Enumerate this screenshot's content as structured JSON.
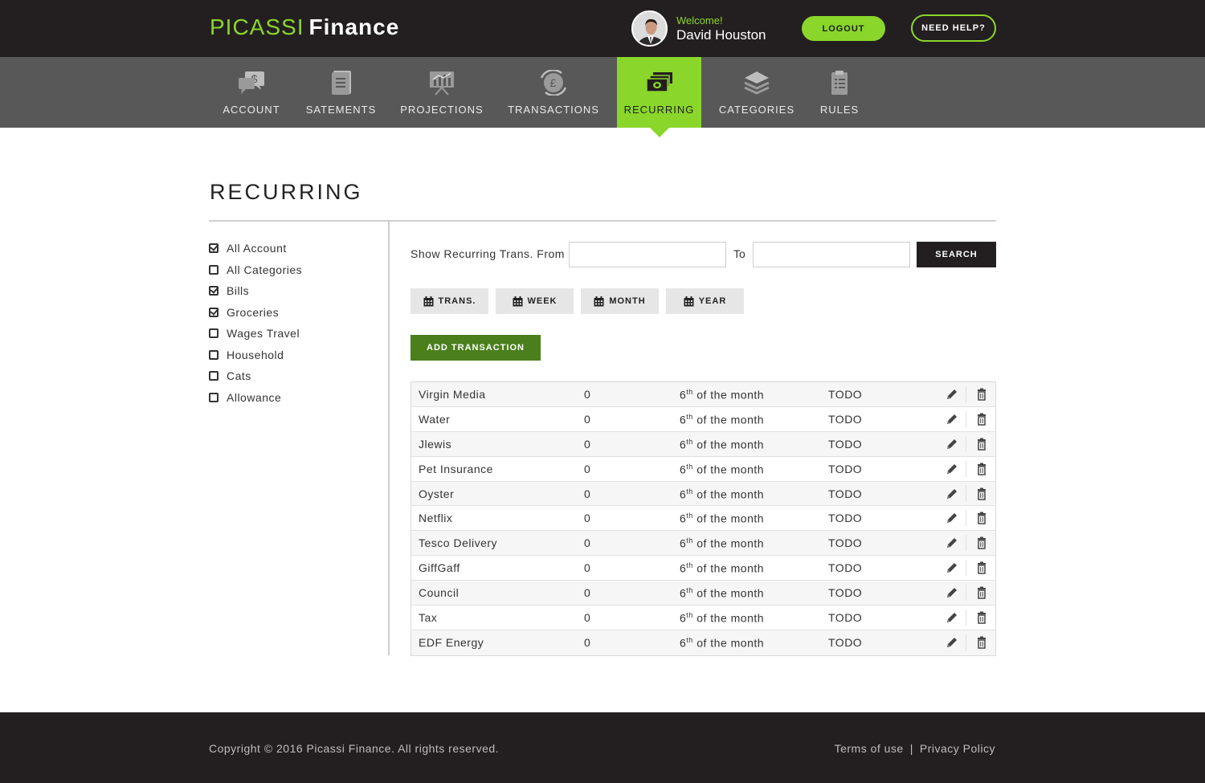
{
  "header": {
    "brand_primary": "PICASSI",
    "brand_secondary": "Finance",
    "welcome": "Welcome!",
    "user_name": "David Houston",
    "logout_label": "LOGOUT",
    "help_label": "NEED HELP?"
  },
  "nav": {
    "items": [
      {
        "label": "ACCOUNT",
        "icon": "account-chat-icon"
      },
      {
        "label": "SATEMENTS",
        "icon": "document-icon"
      },
      {
        "label": "PROJECTIONS",
        "icon": "presentation-chart-icon"
      },
      {
        "label": "TRANSACTIONS",
        "icon": "pound-exchange-icon"
      },
      {
        "label": "RECURRING",
        "icon": "money-stack-icon",
        "active": true
      },
      {
        "label": "CATEGORIES",
        "icon": "layers-icon"
      },
      {
        "label": "RULES",
        "icon": "clipboard-list-icon"
      }
    ]
  },
  "page": {
    "title": "RECURRING"
  },
  "sidebar": {
    "items": [
      {
        "label": "All Account",
        "checked": true
      },
      {
        "label": "All Categories",
        "checked": false
      },
      {
        "label": "Bills",
        "checked": true
      },
      {
        "label": "Groceries",
        "checked": true
      },
      {
        "label": "Wages Travel",
        "checked": false
      },
      {
        "label": "Household",
        "checked": false
      },
      {
        "label": "Cats",
        "checked": false
      },
      {
        "label": "Allowance",
        "checked": false
      }
    ]
  },
  "filter": {
    "from_label": "Show Recurring Trans. From",
    "from_value": "",
    "to_label": "To",
    "to_value": "",
    "search_label": "SEARCH",
    "ranges": [
      "TRANS.",
      "WEEK",
      "MONTH",
      "YEAR"
    ],
    "add_label": "ADD TRANSACTION"
  },
  "transactions": [
    {
      "name": "Virgin Media",
      "amount": "0",
      "day": "6",
      "suffix": "th",
      "schedule": " of the month",
      "status": "TODO"
    },
    {
      "name": "Water",
      "amount": "0",
      "day": "6",
      "suffix": "th",
      "schedule": " of the month",
      "status": "TODO"
    },
    {
      "name": "Jlewis",
      "amount": "0",
      "day": "6",
      "suffix": "th",
      "schedule": " of the month",
      "status": "TODO"
    },
    {
      "name": "Pet Insurance",
      "amount": "0",
      "day": "6",
      "suffix": "th",
      "schedule": " of the month",
      "status": "TODO"
    },
    {
      "name": "Oyster",
      "amount": "0",
      "day": "6",
      "suffix": "th",
      "schedule": " of the month",
      "status": "TODO"
    },
    {
      "name": "Netflix",
      "amount": "0",
      "day": "6",
      "suffix": "th",
      "schedule": " of the month",
      "status": "TODO"
    },
    {
      "name": "Tesco Delivery",
      "amount": "0",
      "day": "6",
      "suffix": "th",
      "schedule": " of the month",
      "status": "TODO"
    },
    {
      "name": "GiffGaff",
      "amount": "0",
      "day": "6",
      "suffix": "th",
      "schedule": " of the month",
      "status": "TODO"
    },
    {
      "name": "Council",
      "amount": "0",
      "day": "6",
      "suffix": "th",
      "schedule": " of the month",
      "status": "TODO"
    },
    {
      "name": "Tax",
      "amount": "0",
      "day": "6",
      "suffix": "th",
      "schedule": " of the month",
      "status": "TODO"
    },
    {
      "name": "EDF Energy",
      "amount": "0",
      "day": "6",
      "suffix": "th",
      "schedule": " of the month",
      "status": "TODO"
    }
  ],
  "footer": {
    "copyright": "Copyright © 2016 Picassi Finance. All rights reserved.",
    "terms": "Terms of use",
    "separator": "|",
    "privacy": "Privacy Policy"
  },
  "colors": {
    "accent": "#8bd62a",
    "dark": "#231f20",
    "nav": "#585858",
    "add_button": "#4a7f1c"
  }
}
